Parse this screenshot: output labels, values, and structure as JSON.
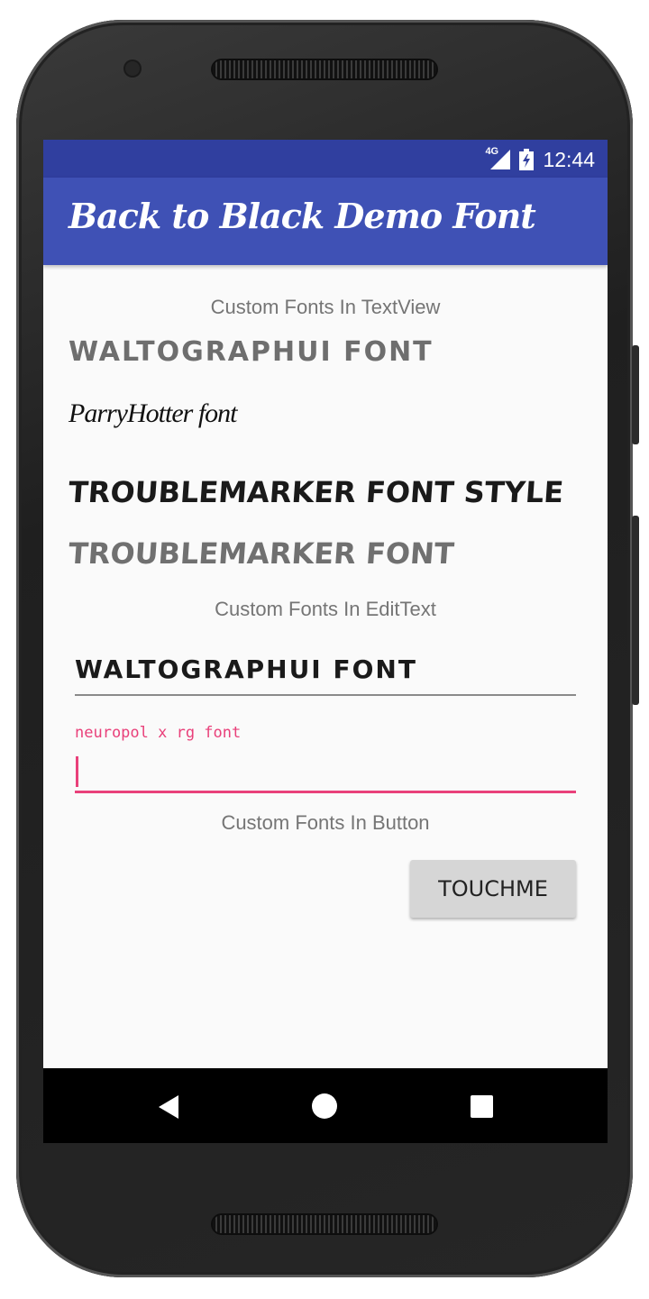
{
  "status_bar": {
    "network": "4G",
    "time": "12:44",
    "signal_icon": "cell-signal-icon",
    "battery_icon": "battery-charging-icon"
  },
  "app_bar": {
    "title": "Back to Black Demo Font"
  },
  "main": {
    "textview_caption": "Custom Fonts In TextView",
    "samples": [
      "WALTOGRAPHUI FONT",
      "ParryHotter font",
      "TROUBLEMARKER FONT STYLE",
      "TROUBLEMARKER FONT"
    ],
    "edittext_caption": "Custom Fonts In EditText",
    "edit1_value": "WALTOGRAPHUI FONT",
    "edit2_hint": "neuropol x rg font",
    "edit2_value": "",
    "button_caption": "Custom Fonts In Button",
    "button_label": "TOUCHME"
  },
  "nav_bar": {
    "back_icon": "back-triangle-icon",
    "home_icon": "home-circle-icon",
    "recents_icon": "recents-square-icon"
  },
  "colors": {
    "status_bar": "#303f9f",
    "app_bar": "#3f51b5",
    "accent": "#e9407a"
  }
}
